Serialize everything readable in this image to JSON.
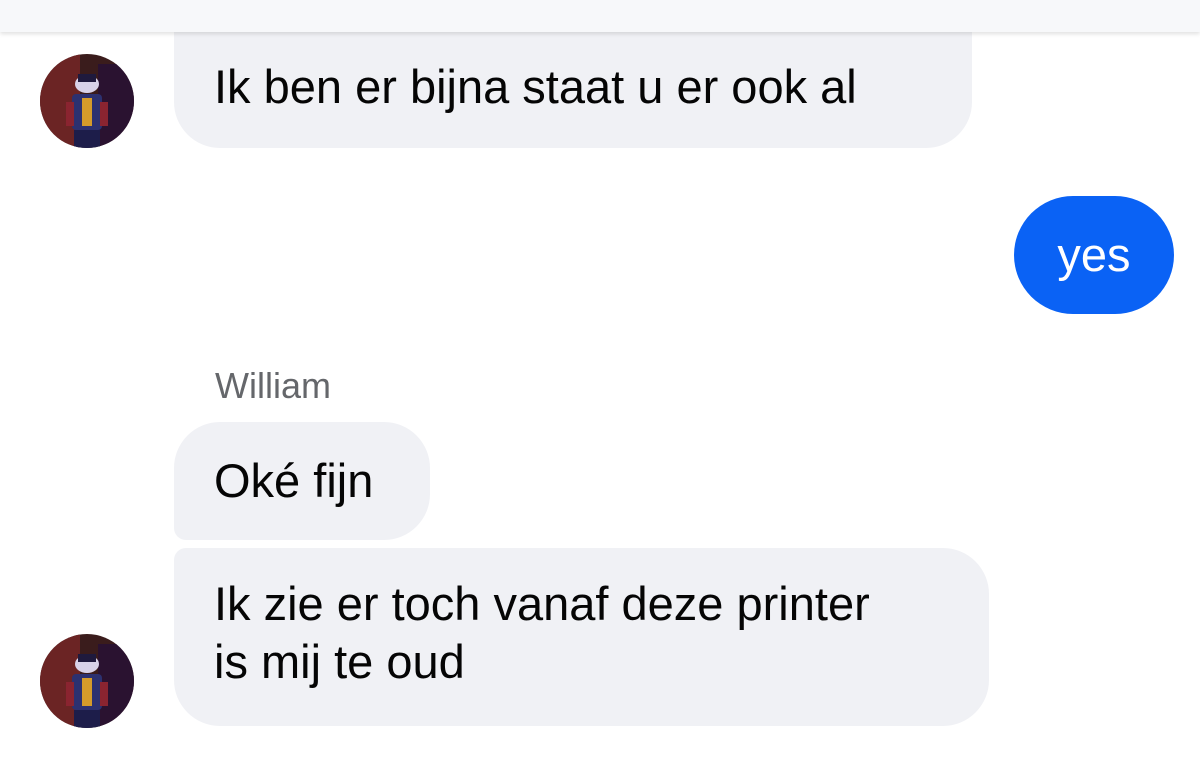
{
  "conversation": {
    "messages": [
      {
        "sender": "other",
        "text": "Ik ben er bijna staat u er ook al"
      },
      {
        "sender": "me",
        "text": "yes"
      },
      {
        "sender_name": "William",
        "text": "Oké fijn"
      },
      {
        "sender": "other",
        "lines": [
          "Ik zie er toch vanaf deze printer",
          "is mij te oud"
        ]
      }
    ]
  },
  "icons": {
    "avatar": "user-avatar-icon"
  },
  "colors": {
    "incoming_bubble": "#f0f1f5",
    "outgoing_bubble": "#0a62f5",
    "sender_name": "#65676b"
  }
}
